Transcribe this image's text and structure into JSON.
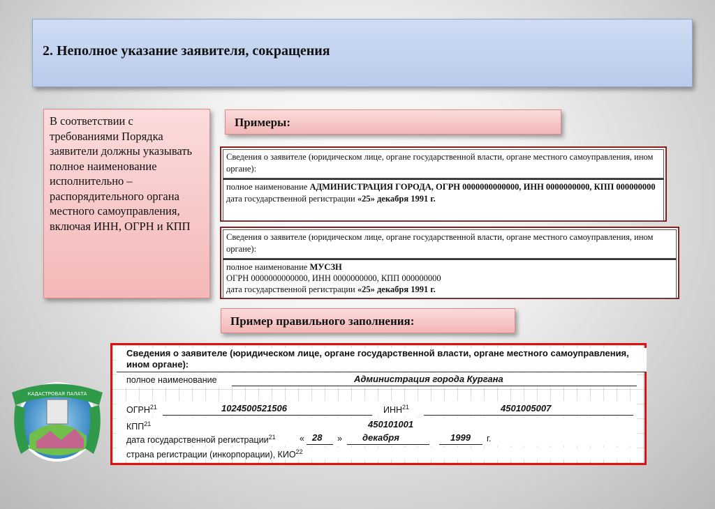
{
  "title": "2. Неполное указание заявителя, сокращения",
  "left_text": "В соответствии с требованиями Порядка заявители должны указывать полное наименование исполнительно – распорядительного органа местного самоуправления, включая ИНН, ОГРН и КПП",
  "examples_label": "Примеры:",
  "example1": {
    "head": "Сведения о заявителе (юридическом лице, органе государственной власти, органе местного самоуправления, ином органе):",
    "line1_prefix": "полное наименование ",
    "line1_bold": "АДМИНИСТРАЦИЯ ГОРОДА, ОГРН 0000000000000, ИНН 0000000000, КПП 000000000",
    "line2_prefix": "дата государственной регистрации ",
    "line2_bold": "«25» декабря 1991 г."
  },
  "example2": {
    "head": "Сведения о заявителе (юридическом лице, органе государственной власти, органе местного самоуправления, ином органе):",
    "line1_prefix": "полное наименование ",
    "line1_bold": "МУСЗН",
    "line2": "ОГРН 0000000000000, ИНН 0000000000, КПП 000000000",
    "line3_prefix": "дата государственной регистрации ",
    "line3_bold": "«25» декабря 1991 г."
  },
  "correct_label": "Пример правильного заполнения:",
  "correct": {
    "head": "Сведения о заявителе (юридическом лице, органе государственной власти, органе местного самоуправления, ином органе):",
    "name_label": "полное наименование",
    "name_value": "Администрация города Кургана",
    "ogrn_label": "ОГРН",
    "ogrn_sup": "21",
    "ogrn_value": "1024500521506",
    "inn_label": "ИНН",
    "inn_sup": "21",
    "inn_value": "4501005007",
    "kpp_label": "КПП",
    "kpp_sup": "21",
    "kpp_value": "450101001",
    "date_label": "дата государственной регистрации",
    "date_sup": "21",
    "quote_open": "«",
    "day": "28",
    "quote_close": "»",
    "month": "декабря",
    "year": "1999",
    "year_suffix": "г.",
    "country_label": "страна регистрации (инкорпорации), КИО",
    "country_sup": "22"
  },
  "logo": {
    "text_top": "КАДАСТРОВАЯ ПАЛАТА"
  }
}
